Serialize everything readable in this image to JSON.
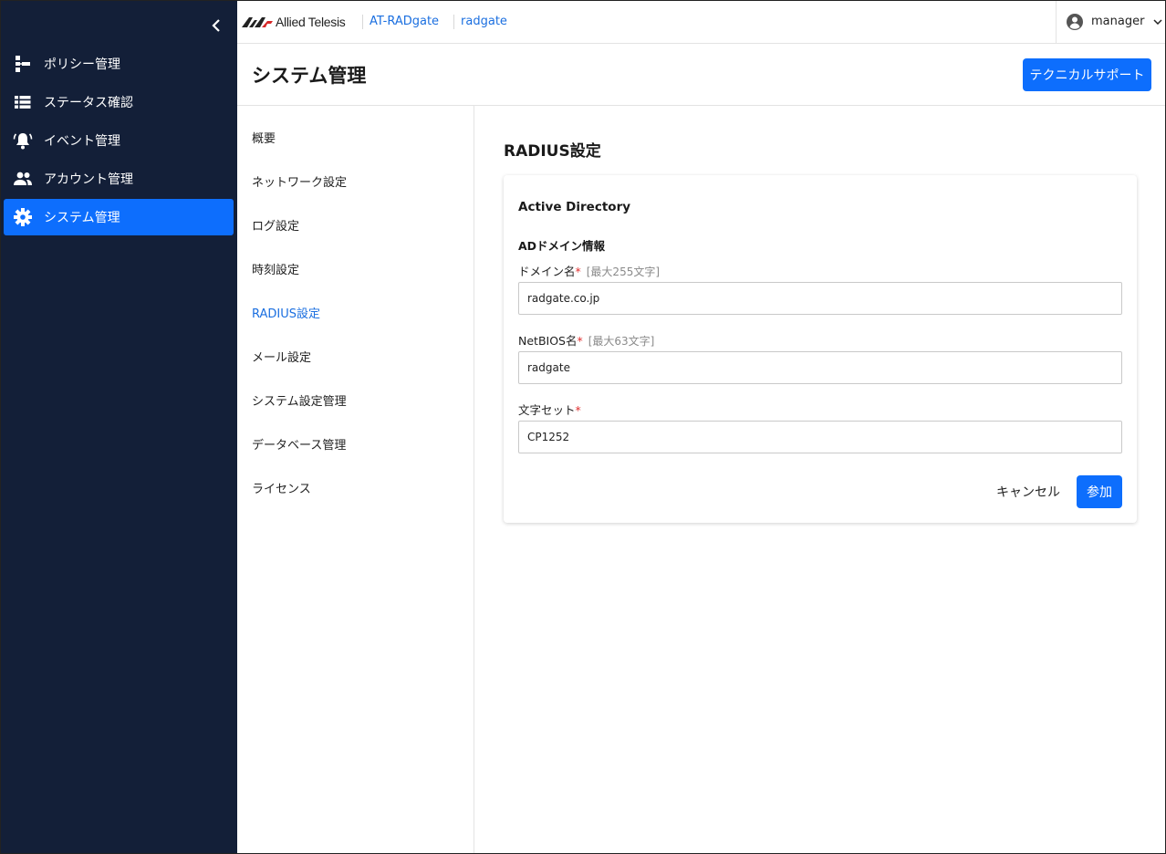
{
  "sidebar": {
    "items": [
      {
        "label": "ポリシー管理",
        "icon": "policy-tree-icon"
      },
      {
        "label": "ステータス確認",
        "icon": "list-icon"
      },
      {
        "label": "イベント管理",
        "icon": "bell-ring-icon"
      },
      {
        "label": "アカウント管理",
        "icon": "users-icon"
      },
      {
        "label": "システム管理",
        "icon": "gear-icon",
        "active": true
      }
    ]
  },
  "header": {
    "logo_text": "Allied Telesis",
    "breadcrumbs": [
      "AT-RADgate",
      "radgate"
    ],
    "user_name": "manager"
  },
  "page": {
    "title": "システム管理",
    "support_button": "テクニカルサポート"
  },
  "submenu": {
    "items": [
      "概要",
      "ネットワーク設定",
      "ログ設定",
      "時刻設定",
      "RADIUS設定",
      "メール設定",
      "システム設定管理",
      "データベース管理",
      "ライセンス"
    ],
    "active_index": 4
  },
  "content": {
    "section_title": "RADIUS設定",
    "card_title": "Active Directory",
    "group_title": "ADドメイン情報",
    "fields": {
      "domain": {
        "label": "ドメイン名",
        "required": "*",
        "hint": "[最大255文字]",
        "value": "radgate.co.jp"
      },
      "netbios": {
        "label": "NetBIOS名",
        "required": "*",
        "hint": "[最大63文字]",
        "value": "radgate"
      },
      "charset": {
        "label": "文字セット",
        "required": "*",
        "value": "CP1252"
      }
    },
    "cancel_button": "キャンセル",
    "join_button": "参加"
  },
  "colors": {
    "sidebar_bg": "#131f38",
    "accent": "#0d6efd",
    "link": "#1b6fe0",
    "required": "#e03131"
  }
}
